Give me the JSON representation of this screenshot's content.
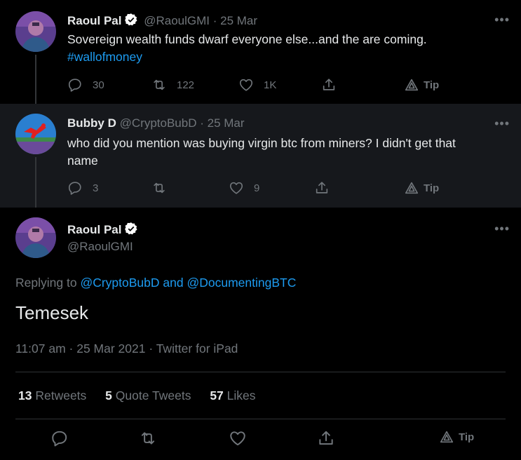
{
  "tweet1": {
    "name": "Raoul Pal",
    "handle": "@RaoulGMI",
    "sep": "·",
    "date": "25 Mar",
    "text": "Sovereign wealth funds dwarf everyone else...and the are coming.",
    "hashtag": "#wallofmoney",
    "replies": "30",
    "retweets": "122",
    "likes": "1K",
    "tip": "Tip"
  },
  "tweet2": {
    "name": "Bubby D",
    "handle": "@CryptoBubD",
    "sep": "·",
    "date": "25 Mar",
    "text": "who did you mention was buying virgin btc from miners? I didn't get that name",
    "replies": "3",
    "retweets": "",
    "likes": "9",
    "tip": "Tip"
  },
  "main": {
    "name": "Raoul Pal",
    "handle": "@RaoulGMI",
    "replying_prefix": "Replying to",
    "reply_to_1": "@CryptoBubD",
    "reply_and": "and",
    "reply_to_2": "@DocumentingBTC",
    "text": "Temesek",
    "timestamp": "11:07 am · 25 Mar 2021 · Twitter for iPad",
    "stats": [
      {
        "count": "13",
        "label": "Retweets"
      },
      {
        "count": "5",
        "label": "Quote Tweets"
      },
      {
        "count": "57",
        "label": "Likes"
      }
    ],
    "tip": "Tip"
  },
  "more_glyph": "•••",
  "colors": {
    "background": "#000000",
    "tweet2_background": "#16181c",
    "link": "#1d9bf0",
    "verified": "#ffffff",
    "muted": "#71767b"
  }
}
